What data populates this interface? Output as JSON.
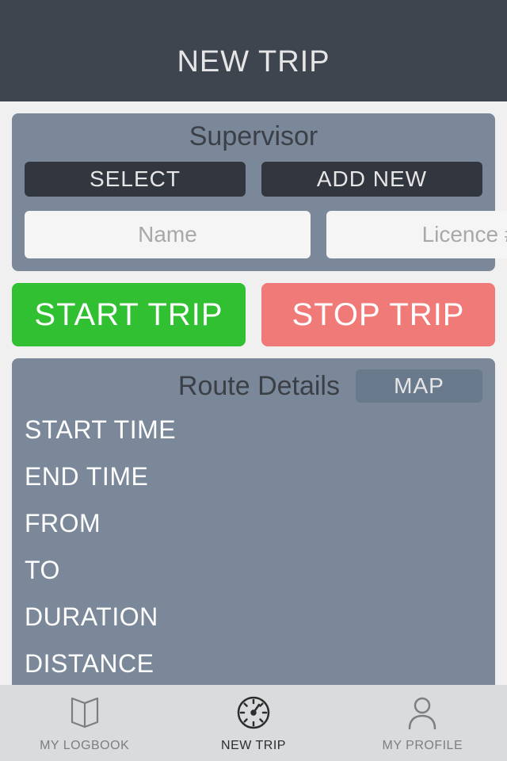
{
  "header": {
    "title": "NEW TRIP"
  },
  "supervisor": {
    "title": "Supervisor",
    "select_label": "SELECT",
    "addnew_label": "ADD NEW",
    "name_placeholder": "Name",
    "licence_placeholder": "Licence #"
  },
  "trip": {
    "start_label": "START TRIP",
    "stop_label": "STOP TRIP"
  },
  "route": {
    "title": "Route Details",
    "map_label": "MAP",
    "fields": {
      "start_time": "START TIME",
      "end_time": "END TIME",
      "from": "FROM",
      "to": "TO",
      "duration": "DURATION",
      "distance": "DISTANCE"
    }
  },
  "tabs": {
    "logbook": "MY LOGBOOK",
    "newtrip": "NEW TRIP",
    "profile": "MY PROFILE"
  }
}
